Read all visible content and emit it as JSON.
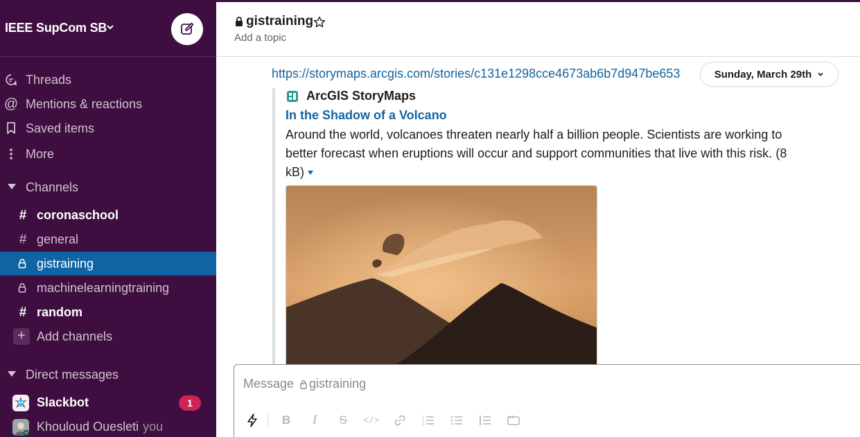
{
  "workspace": {
    "name": "IEEE SupCom SB"
  },
  "nav": {
    "threads": "Threads",
    "mentions": "Mentions & reactions",
    "saved": "Saved items",
    "more": "More"
  },
  "channels": {
    "section_label": "Channels",
    "items": [
      {
        "name": "coronaschool",
        "type": "public",
        "unread": true
      },
      {
        "name": "general",
        "type": "public",
        "unread": false
      },
      {
        "name": "gistraining",
        "type": "private",
        "active": true
      },
      {
        "name": "machinelearningtraining",
        "type": "private",
        "unread": false
      },
      {
        "name": "random",
        "type": "public",
        "unread": true
      }
    ],
    "add_label": "Add channels"
  },
  "dms": {
    "section_label": "Direct messages",
    "items": [
      {
        "name": "Slackbot",
        "badge": "1"
      },
      {
        "name": "Khouloud Ouesleti",
        "suffix": "you"
      }
    ]
  },
  "channel_header": {
    "title": "gistraining",
    "topic": "Add a topic"
  },
  "message": {
    "link": "https://storymaps.arcgis.com/stories/c131e1298cce4673ab6b7d947be653",
    "date_divider": "Sunday, March 29th",
    "attachment": {
      "service": "ArcGIS StoryMaps",
      "title": "In the Shadow of a Volcano",
      "description": "Around the world, volcanoes threaten nearly half a billion people. Scientists are working to better forecast when eruptions will occur and support communities that live with this risk.",
      "size": "(8 kB)"
    }
  },
  "composer": {
    "placeholder_prefix": "Message",
    "placeholder_channel": "gistraining"
  },
  "colors": {
    "sidebar_bg": "#3f0e40",
    "active_channel": "#1164a3",
    "link": "#1264a3",
    "badge": "#cd2553"
  }
}
